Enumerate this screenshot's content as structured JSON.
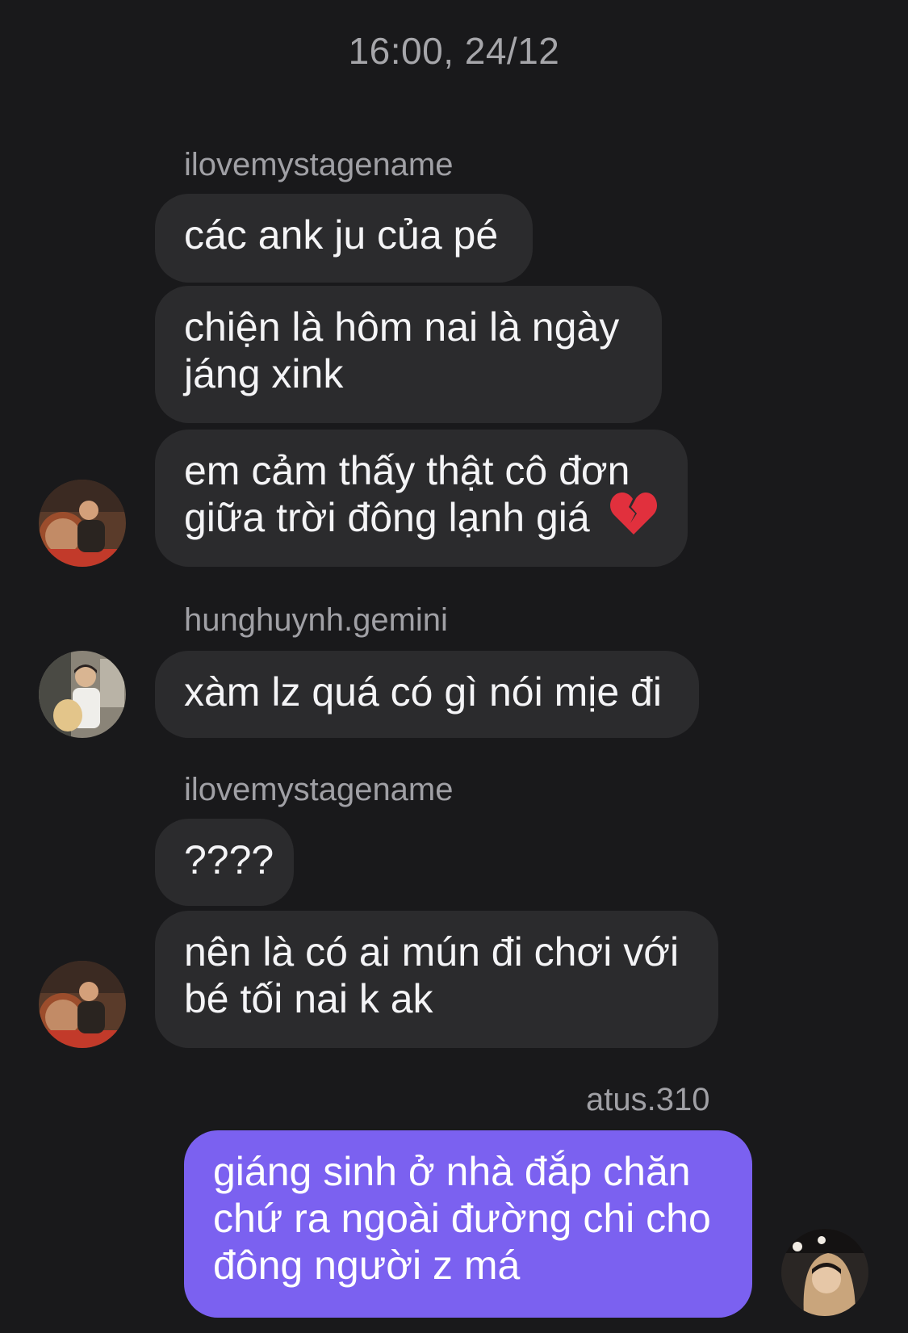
{
  "timestamp": "16:00, 24/12",
  "colors": {
    "background": "#19191b",
    "bubble_incoming": "#2b2b2d",
    "bubble_outgoing": "#7b61f0",
    "sender_text": "#a0a0a5"
  },
  "messages": {
    "group1": {
      "sender": "ilovemystagename",
      "m1": "các ank ju của pé",
      "m2_l1": "chiện là hôm nai là ngày",
      "m2_l2": "jáng xink",
      "m3_l1": "em cảm thấy thật cô đơn",
      "m3_l2": "giữa trời đông lạnh giá",
      "m3_emoji": "broken-heart-icon"
    },
    "group2": {
      "sender": "hunghuynh.gemini",
      "m1": "xàm lz quá có gì nói mịe đi"
    },
    "group3": {
      "sender": "ilovemystagename",
      "m1": "????",
      "m2_l1": "nên là có ai mún đi chơi với",
      "m2_l2": "bé tối nai k ak"
    },
    "group4": {
      "sender": "atus.310",
      "m1_l1": "giáng sinh ở nhà đắp chăn",
      "m1_l2": "chứ ra ngoài đường chi cho",
      "m1_l3": "đông người z má"
    }
  }
}
